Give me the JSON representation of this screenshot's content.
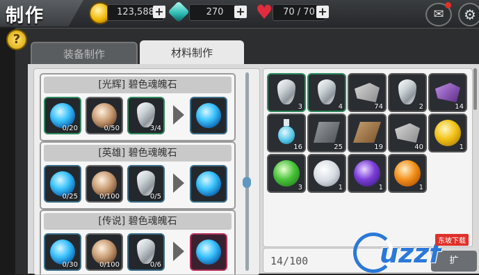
{
  "header": {
    "title": "制作",
    "gold": "123,588",
    "crystals": "270",
    "hearts": "70 / 70",
    "plus_label": "+"
  },
  "help_label": "?",
  "tabs": [
    {
      "label": "装备制作",
      "active": false
    },
    {
      "label": "材料制作",
      "active": true
    }
  ],
  "recipes": [
    {
      "title": "[光辉] 碧色魂魄石",
      "inputs": [
        {
          "icon": "blue-orb-icon",
          "count": "0/20"
        },
        {
          "icon": "bronze-orb-icon",
          "count": "0/50"
        },
        {
          "icon": "crystal-icon",
          "count": "3/4"
        }
      ],
      "output_icon": "blue-soul-stone-icon"
    },
    {
      "title": "[英雄] 碧色魂魄石",
      "inputs": [
        {
          "icon": "blue-orb-icon",
          "count": "0/25"
        },
        {
          "icon": "bronze-orb-icon",
          "count": "0/100"
        },
        {
          "icon": "crystal-icon",
          "count": "0/5"
        }
      ],
      "output_icon": "blue-soul-stone-icon"
    },
    {
      "title": "[传说] 碧色魂魄石",
      "inputs": [
        {
          "icon": "blue-orb-icon",
          "count": "0/30"
        },
        {
          "icon": "bronze-orb-icon",
          "count": "0/100"
        },
        {
          "icon": "crystal-icon",
          "count": "0/6"
        }
      ],
      "output_icon": "blue-soul-stone-icon"
    }
  ],
  "inventory": [
    {
      "icon": "crystal-icon",
      "count": "3"
    },
    {
      "icon": "crystal-icon",
      "count": "4"
    },
    {
      "icon": "grey-cloth-icon",
      "count": "74"
    },
    {
      "icon": "crystal-icon",
      "count": "2"
    },
    {
      "icon": "purple-cloth-icon",
      "count": "14"
    },
    {
      "icon": "potion-icon",
      "count": "16"
    },
    {
      "icon": "iron-ingot-icon",
      "count": "25"
    },
    {
      "icon": "wood-plank-icon",
      "count": "19"
    },
    {
      "icon": "grey-cloth-icon",
      "count": "40"
    },
    {
      "icon": "yellow-orb-icon",
      "count": "1"
    },
    {
      "icon": "green-orb-icon",
      "count": "3"
    },
    {
      "icon": "white-orb-icon",
      "count": "1"
    },
    {
      "icon": "purple-orb-icon",
      "count": "1"
    },
    {
      "icon": "orange-orb-icon",
      "count": "1"
    }
  ],
  "capacity": "14/100",
  "expand_label": "扩",
  "watermark": {
    "logo": "uzzf",
    "sub": "东坡下载"
  }
}
